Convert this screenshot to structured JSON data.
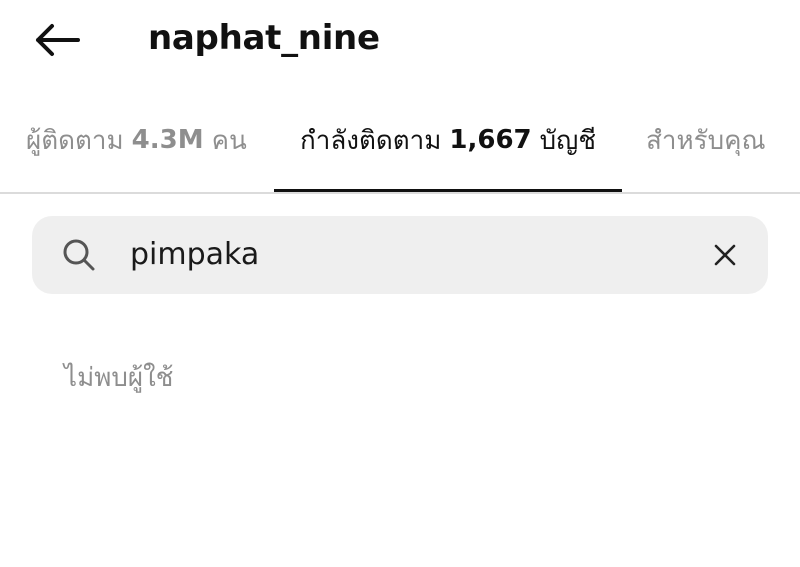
{
  "header": {
    "title": "naphat_nine",
    "back_icon": "arrow-left-icon"
  },
  "tabs": [
    {
      "prefix": "ผู้ติดตาม ",
      "count": "4.3M",
      "suffix": " คน",
      "active": false
    },
    {
      "prefix": "กำลังติดตาม ",
      "count": "1,667",
      "suffix": " บัญชี",
      "active": true
    },
    {
      "label": "สำหรับคุณ",
      "active": false
    }
  ],
  "search": {
    "icon": "search-icon",
    "value": "pimpaka",
    "clear_icon": "close-icon"
  },
  "results": {
    "empty_message": "ไม่พบผู้ใช้"
  },
  "colors": {
    "text_primary": "#111111",
    "text_secondary": "#8e8e8e",
    "search_bg": "#efefef",
    "divider": "#dbdbdb"
  }
}
